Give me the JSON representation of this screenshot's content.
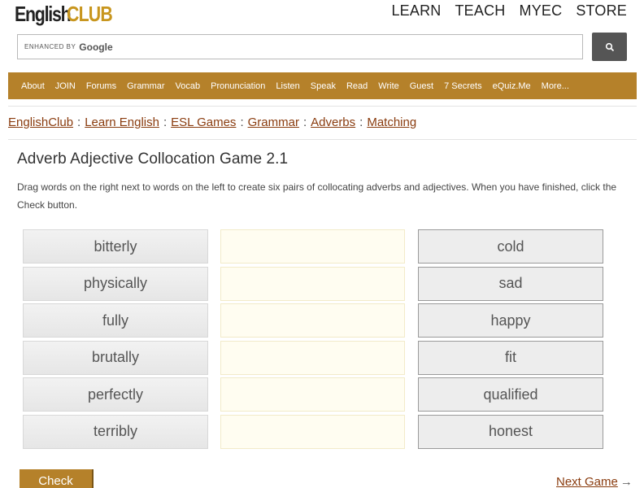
{
  "logo": {
    "part1": "English",
    "part2": "CLUB"
  },
  "topnav": [
    "LEARN",
    "TEACH",
    "MYEC",
    "STORE"
  ],
  "search": {
    "enhanced": "ENHANCED BY",
    "google": "Google"
  },
  "mainnav": [
    "About",
    "JOIN",
    "Forums",
    "Grammar",
    "Vocab",
    "Pronunciation",
    "Listen",
    "Speak",
    "Read",
    "Write",
    "Guest",
    "7 Secrets",
    "eQuiz.Me",
    "More..."
  ],
  "breadcrumb": [
    "EnglishClub",
    "Learn English",
    "ESL Games",
    "Grammar",
    "Adverbs",
    "Matching"
  ],
  "breadcrumb_sep": ":",
  "title": "Adverb Adjective Collocation Game 2.1",
  "instructions": "Drag words on the right next to words on the left to create six pairs of collocating adverbs and adjectives. When you have finished, click the Check button.",
  "game": {
    "left": [
      "bitterly",
      "physically",
      "fully",
      "brutally",
      "perfectly",
      "terribly"
    ],
    "right": [
      "cold",
      "sad",
      "happy",
      "fit",
      "qualified",
      "honest"
    ]
  },
  "check_label": "Check",
  "next_game_label": "Next Game",
  "next_arrow": "→",
  "colors": {
    "brand": "#b5812a",
    "link": "#8a3c0f"
  }
}
